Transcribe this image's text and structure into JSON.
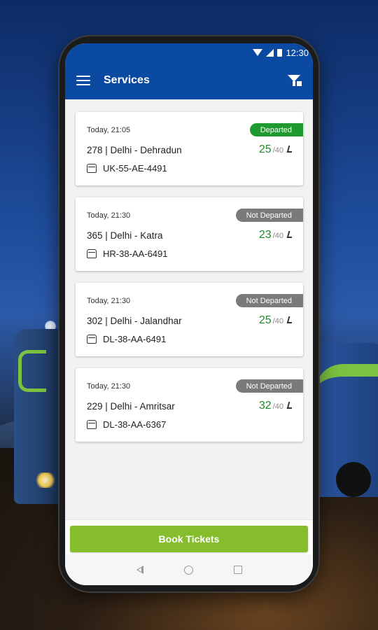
{
  "status_bar": {
    "time": "12:30"
  },
  "app_bar": {
    "title": "Services",
    "menu_icon": "hamburger-icon",
    "filter_icon": "filter-icon"
  },
  "services": [
    {
      "time": "Today, 21:05",
      "route": "278 | Delhi - Dehradun",
      "bus": "UK-55-AE-4491",
      "status": "Departed",
      "seats_available": "25",
      "seats_total": "/40"
    },
    {
      "time": "Today, 21:30",
      "route": "365 | Delhi - Katra",
      "bus": "HR-38-AA-6491",
      "status": "Not Departed",
      "seats_available": "23",
      "seats_total": "/40"
    },
    {
      "time": "Today, 21:30",
      "route": "302 | Delhi - Jalandhar",
      "bus": "DL-38-AA-6491",
      "status": "Not Departed",
      "seats_available": "25",
      "seats_total": "/40"
    },
    {
      "time": "Today, 21:30",
      "route": "229 | Delhi - Amritsar",
      "bus": "DL-38-AA-6367",
      "status": "Not Departed",
      "seats_available": "32",
      "seats_total": "/40"
    }
  ],
  "book_button": {
    "label": "Book Tickets"
  },
  "colors": {
    "primary": "#0b4aa2",
    "departed": "#1f9a2e",
    "not_departed": "#7a7a7a",
    "seats": "#1f8a2a",
    "book_button": "#86bd2d"
  }
}
